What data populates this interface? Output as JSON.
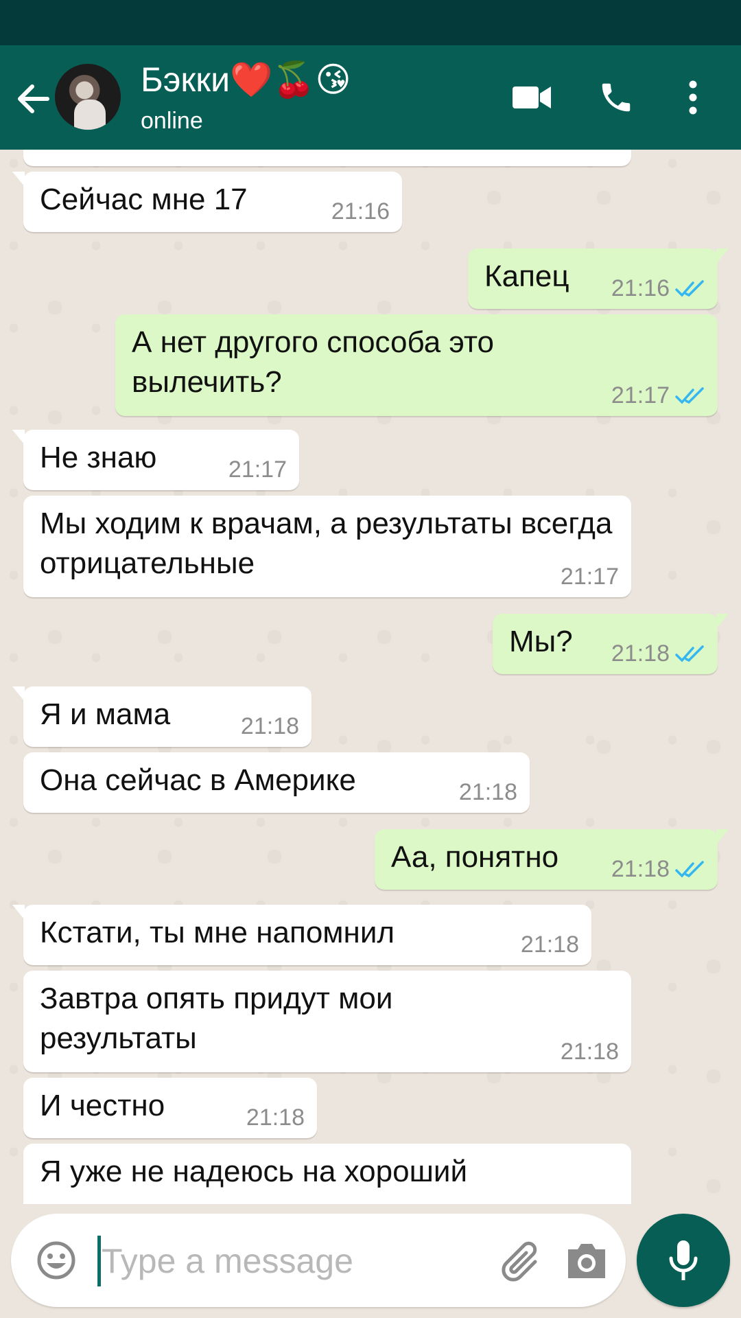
{
  "header": {
    "contact_name": "Бэкки❤️🍒😘",
    "status": "online"
  },
  "colors": {
    "header_bg": "#075e54",
    "status_bar_bg": "#043a3a",
    "incoming_bubble": "#ffffff",
    "outgoing_bubble": "#dcf8c6",
    "read_ticks": "#34b7f1",
    "chat_bg": "#ece5dd"
  },
  "messages": [
    {
      "dir": "in",
      "text": "Сейчас мне 17",
      "time": "21:16",
      "read": false
    },
    {
      "dir": "out",
      "text": "Капец",
      "time": "21:16",
      "read": true
    },
    {
      "dir": "out",
      "text": "А нет другого способа это вылечить?",
      "time": "21:17",
      "read": true
    },
    {
      "dir": "in",
      "text": "Не знаю",
      "time": "21:17",
      "read": false
    },
    {
      "dir": "in",
      "text": "Мы ходим к врачам, а результаты всегда отрицательные",
      "time": "21:17",
      "read": false
    },
    {
      "dir": "out",
      "text": "Мы?",
      "time": "21:18",
      "read": true
    },
    {
      "dir": "in",
      "text": "Я и мама",
      "time": "21:18",
      "read": false
    },
    {
      "dir": "in",
      "text": "Она сейчас в Америке",
      "time": "21:18",
      "read": false
    },
    {
      "dir": "out",
      "text": "Аа, понятно",
      "time": "21:18",
      "read": true
    },
    {
      "dir": "in",
      "text": "Кстати, ты мне напомнил",
      "time": "21:18",
      "read": false
    },
    {
      "dir": "in",
      "text": "Завтра опять придут мои результаты",
      "time": "21:18",
      "read": false
    },
    {
      "dir": "in",
      "text": "И честно",
      "time": "21:18",
      "read": false
    },
    {
      "dir": "in",
      "text": "Я уже не надеюсь на хороший",
      "time": "",
      "read": false
    }
  ],
  "input": {
    "placeholder": "Type a message"
  },
  "icons": {
    "back": "arrow-left-icon",
    "video": "video-camera-icon",
    "call": "phone-icon",
    "menu": "more-vertical-icon",
    "emoji": "smiley-icon",
    "attach": "paperclip-icon",
    "camera": "camera-icon",
    "mic": "microphone-icon",
    "ticks": "double-check-icon"
  }
}
